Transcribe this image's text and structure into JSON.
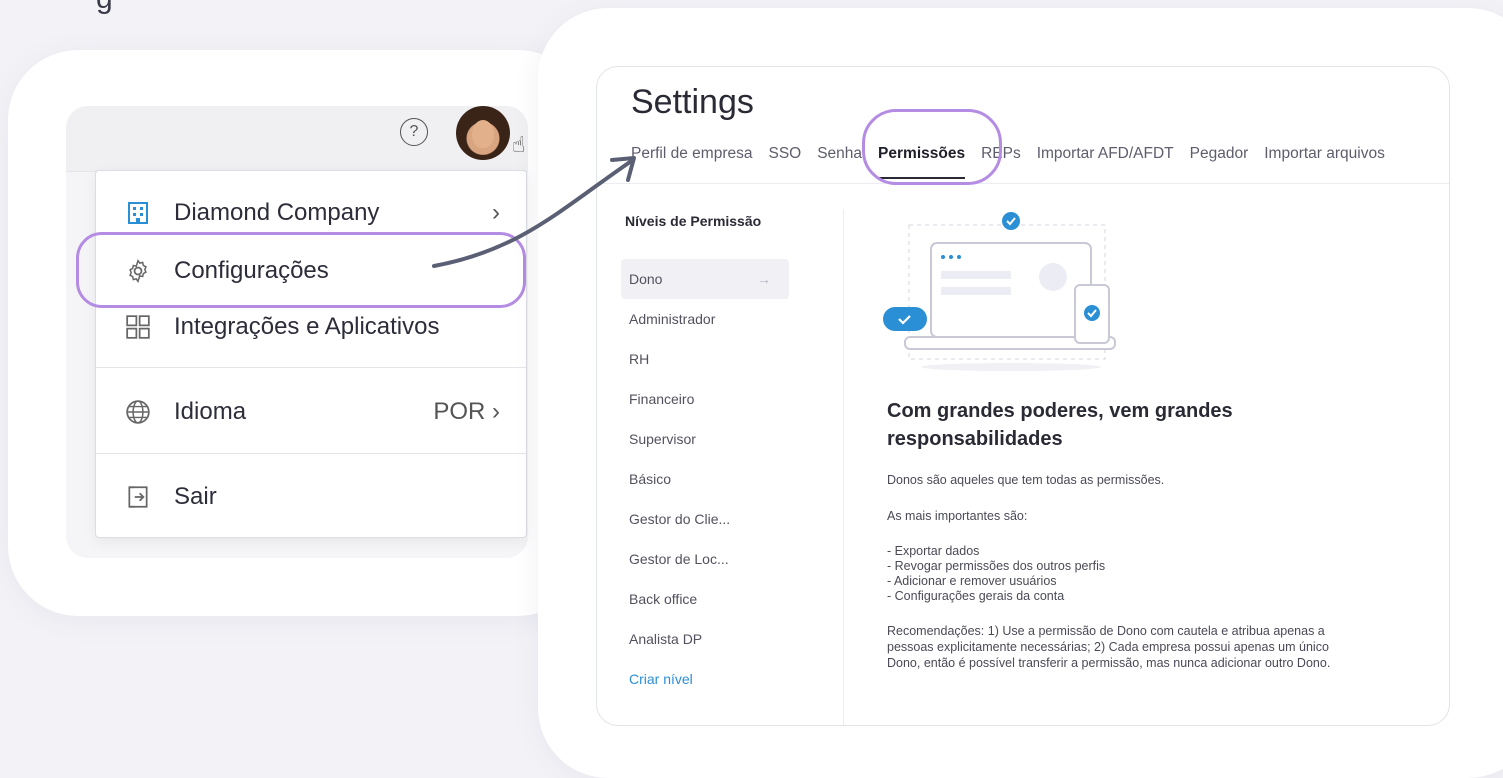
{
  "top_word": "g",
  "left_panel": {
    "help_icon": "?",
    "menu": {
      "items": [
        {
          "label": "Diamond Company",
          "icon": "building-icon",
          "right": "›"
        },
        {
          "label": "Configurações",
          "icon": "gear-icon",
          "right": ""
        },
        {
          "label": "Integrações e Aplicativos",
          "icon": "grid-icon",
          "right": ""
        },
        {
          "label": "Idioma",
          "icon": "globe-icon",
          "right": "POR  ›"
        },
        {
          "label": "Sair",
          "icon": "logout-icon",
          "right": ""
        }
      ]
    }
  },
  "settings": {
    "title": "Settings",
    "tabs": [
      "Perfil de empresa",
      "SSO",
      "Senha",
      "Permissões",
      "REPs",
      "Importar AFD/AFDT",
      "Pegador",
      "Importar arquivos"
    ],
    "active_tab": "Permissões",
    "permissions": {
      "title": "Níveis de Permissão",
      "levels": [
        "Dono",
        "Administrador",
        "RH",
        "Financeiro",
        "Supervisor",
        "Básico",
        "Gestor do Clie...",
        "Gestor de Loc...",
        "Back office",
        "Analista DP"
      ],
      "create_label": "Criar nível",
      "active_level": "Dono",
      "active_arrow": "→"
    },
    "content": {
      "heading": "Com grandes poderes, vem grandes responsabilidades",
      "intro": "Donos são aqueles que tem todas as permissões.",
      "important_label": "As mais importantes são:",
      "bullets": [
        "- Exportar dados",
        "- Revogar permissões dos outros perfis",
        "- Adicionar e remover usuários",
        "- Configurações gerais da conta"
      ],
      "recommendations": "Recomendações: 1) Use a permissão de Dono com cautela e atribua apenas a pessoas explicitamente necessárias; 2) Cada empresa possui apenas um único Dono, então é possível transferir a permissão, mas nunca adicionar outro Dono."
    }
  },
  "colors": {
    "highlight": "#b48ce4",
    "link": "#2b8fd6",
    "check": "#2b8fd6"
  }
}
